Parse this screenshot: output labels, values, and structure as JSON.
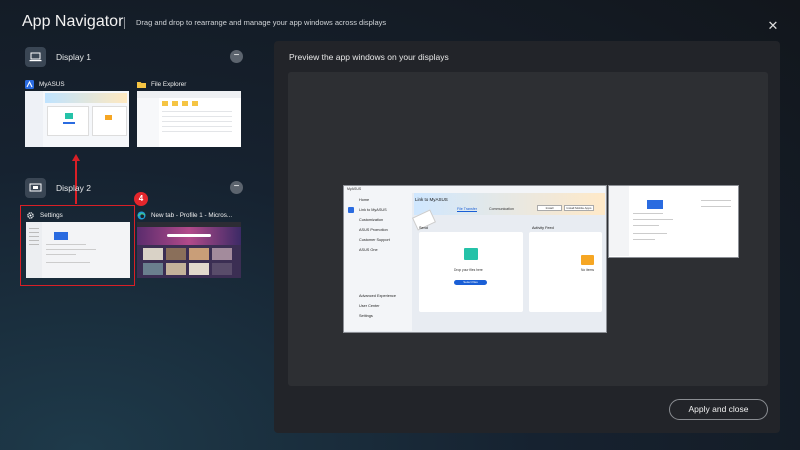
{
  "header": {
    "title": "App Navigator",
    "subtitle": "Drag and drop to rearrange and manage your app windows across displays",
    "close_icon": "close-icon"
  },
  "displays": [
    {
      "label": "Display 1",
      "icon": "laptop-icon",
      "collapse_icon": "minus-icon",
      "windows": [
        {
          "title": "MyASUS",
          "icon": "myasus-icon"
        },
        {
          "title": "File Explorer",
          "icon": "folder-icon"
        }
      ]
    },
    {
      "label": "Display 2",
      "icon": "monitor-icon",
      "collapse_icon": "minus-icon",
      "windows": [
        {
          "title": "Settings",
          "icon": "gear-icon"
        },
        {
          "title": "New tab - Profile 1 - Micros...",
          "icon": "edge-icon"
        }
      ]
    }
  ],
  "annotation": {
    "step_badge": "4",
    "color": "#d91f26"
  },
  "preview": {
    "title": "Preview the app windows on your displays",
    "main_screen": {
      "app_label": "MyASUS",
      "page_title": "Link to MyASUS",
      "tabs": [
        "File Transfer",
        "Communication"
      ],
      "sidebar_items": [
        "Home",
        "Link to MyASUS",
        "Customization",
        "ASUS Promotion",
        "Customer Support",
        "ASUS One",
        "Advanced Experience",
        "User Center",
        "Settings"
      ],
      "send_label": "Send",
      "drop_text": "Drop your files here",
      "select_files_label": "Select files",
      "activity_label": "Activity Feed",
      "no_items_text": "No items",
      "top_buttons": [
        "Install",
        "Install Mobile Apps"
      ]
    }
  },
  "actions": {
    "apply_label": "Apply and close"
  },
  "colors": {
    "accent_blue": "#1a5fd6",
    "panel_bg": "#222429",
    "canvas_bg": "#2d2f33"
  }
}
